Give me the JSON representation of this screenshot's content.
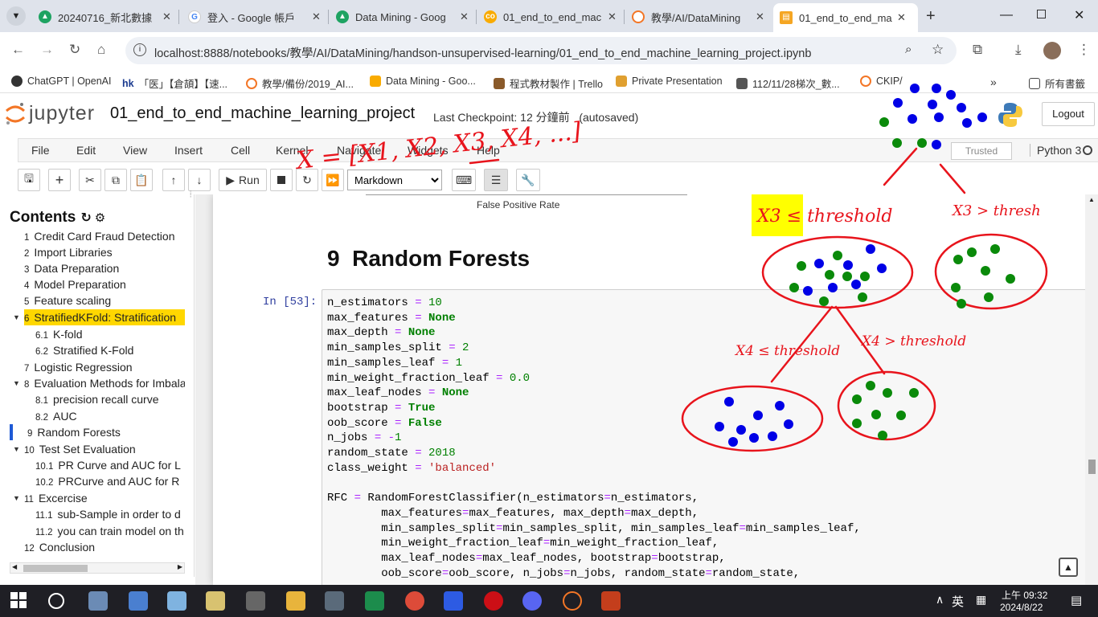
{
  "tabs": [
    {
      "title": "20240716_新北數據",
      "favicon_color": "#1ea362"
    },
    {
      "title": "登入 - Google 帳戶",
      "favicon_color": "#4285f4"
    },
    {
      "title": "Data Mining - Goog",
      "favicon_color": "#1ea362"
    },
    {
      "title": "01_end_to_end_mac",
      "favicon_color": "#f5a623"
    },
    {
      "title": "教學/AI/DataMining",
      "favicon_color": "#f37626"
    },
    {
      "title": "01_end_to_end_mac",
      "favicon_color": "#f5a623"
    }
  ],
  "address_bar": {
    "url": "localhost:8888/notebooks/教學/AI/DataMining/handson-unsupervised-learning/01_end_to_end_machine_learning_project.ipynb"
  },
  "bookmarks": [
    {
      "label": "ChatGPT | OpenAI"
    },
    {
      "label": "「医」【倉頡】【速..."
    },
    {
      "label": "教學/備份/2019_AI..."
    },
    {
      "label": "Data Mining - Goo..."
    },
    {
      "label": "程式教材製作 | Trello"
    },
    {
      "label": "Private Presentation"
    },
    {
      "label": "112/11/28梯次_數..."
    },
    {
      "label": "CKIP/"
    },
    {
      "label": "所有書籤"
    }
  ],
  "jupyter": {
    "logo_text": "jupyter",
    "notebook_name": "01_end_to_end_machine_learning_project",
    "checkpoint": "Last Checkpoint: 12 分鐘前",
    "autosave": "(autosaved)",
    "logout": "Logout",
    "menus": [
      "File",
      "Edit",
      "View",
      "Insert",
      "Cell",
      "Kernel",
      "Navigate",
      "Widgets",
      "Help"
    ],
    "trusted": "Trusted",
    "kernel": "Python 3",
    "toolbar": {
      "run": "Run",
      "cell_type": "Markdown"
    }
  },
  "toc": {
    "title": "Contents",
    "items": [
      {
        "num": "1",
        "label": "Credit Card Fraud Detection"
      },
      {
        "num": "2",
        "label": "Import Libraries"
      },
      {
        "num": "3",
        "label": "Data Preparation"
      },
      {
        "num": "4",
        "label": "Model Preparation"
      },
      {
        "num": "5",
        "label": "Feature scaling"
      },
      {
        "num": "6",
        "label": "StratifiedKFold: Stratification"
      },
      {
        "num": "6.1",
        "label": "K-fold"
      },
      {
        "num": "6.2",
        "label": "Stratified K-Fold"
      },
      {
        "num": "7",
        "label": "Logistic Regression"
      },
      {
        "num": "8",
        "label": "Evaluation Methods for Imbala"
      },
      {
        "num": "8.1",
        "label": "precision recall curve"
      },
      {
        "num": "8.2",
        "label": "AUC"
      },
      {
        "num": "9",
        "label": "Random Forests"
      },
      {
        "num": "10",
        "label": "Test Set Evaluation"
      },
      {
        "num": "10.1",
        "label": "PR Curve and AUC for L"
      },
      {
        "num": "10.2",
        "label": "PRCurve and AUC for R"
      },
      {
        "num": "11",
        "label": "Excercise"
      },
      {
        "num": "11.1",
        "label": "sub-Sample in order to d"
      },
      {
        "num": "11.2",
        "label": "you can train model on th"
      },
      {
        "num": "12",
        "label": "Conclusion"
      }
    ]
  },
  "notebook": {
    "plot_xlabel": "False Positive Rate",
    "heading_num": "9",
    "heading": "Random Forests",
    "prompt": "In [53]:"
  },
  "annotations": {
    "top_formula": "X = [X1, X2, X3, X4, ...]",
    "x3_le": "X3 ≤ threshold",
    "x3_gt": "X3 > thresh",
    "x4_le": "X4 ≤ threshold",
    "x4_gt": "X4 > threshold"
  },
  "taskbar": {
    "ime": "英",
    "time": "上午 09:32",
    "date": "2024/8/22"
  }
}
